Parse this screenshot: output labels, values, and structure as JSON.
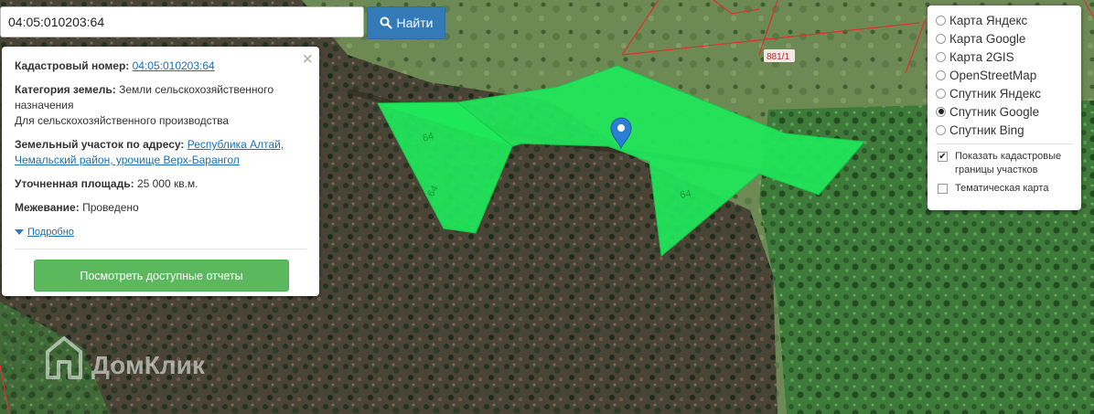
{
  "search": {
    "value": "04:05:010203:64",
    "button_label": "Найти"
  },
  "info": {
    "cadastral_label": "Кадастровый номер:",
    "cadastral_value": "04:05:010203:64",
    "category_label": "Категория земель:",
    "category_value": "Земли сельскохозяйственного назначения",
    "category_sub": "Для сельскохозяйственного производства",
    "address_label": "Земельный участок по адресу:",
    "address_value": "Республика Алтай, Чемальский район, урочище Верх-Барангол",
    "area_label": "Уточненная площадь:",
    "area_value": "25 000 кв.м.",
    "survey_label": "Межевание:",
    "survey_value": "Проведено",
    "details_link": "Подробно",
    "reports_button": "Посмотреть доступные отчеты"
  },
  "layers": {
    "options": [
      {
        "label": "Карта Яндекс",
        "selected": false
      },
      {
        "label": "Карта Google",
        "selected": false
      },
      {
        "label": "Карта 2GIS",
        "selected": false
      },
      {
        "label": "OpenStreetMap",
        "selected": false
      },
      {
        "label": "Спутник Яндекс",
        "selected": false
      },
      {
        "label": "Спутник Google",
        "selected": true
      },
      {
        "label": "Спутник Bing",
        "selected": false
      }
    ],
    "show_cadastral_label": "Показать кадастровые границы участков",
    "show_cadastral_checked": true,
    "thematic_label": "Тематическая карта",
    "thematic_checked": false
  },
  "map": {
    "parcel_labels": [
      "64",
      "64",
      "64"
    ],
    "neighbor_label": "881/1",
    "watermark": "ДомКлик",
    "parcel_color": "#1ee85a",
    "boundary_color": "#e03030",
    "marker_color": "#2a7fd4"
  }
}
